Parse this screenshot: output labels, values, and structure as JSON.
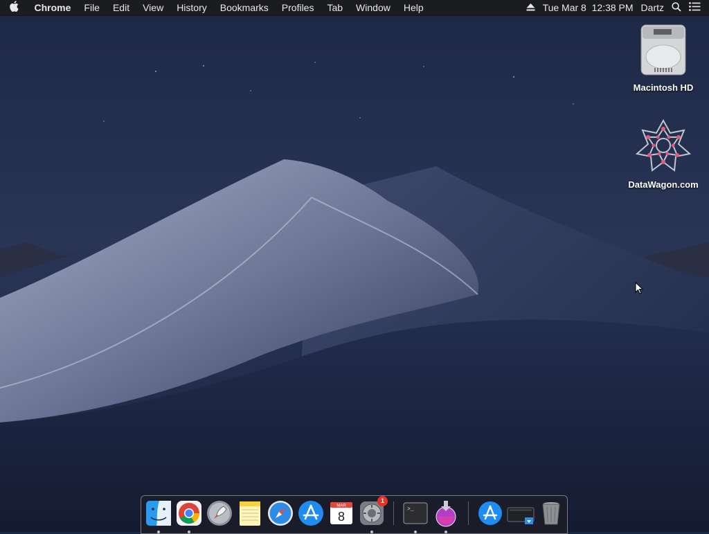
{
  "menubar": {
    "app_name": "Chrome",
    "menus": [
      "File",
      "Edit",
      "View",
      "History",
      "Bookmarks",
      "Profiles",
      "Tab",
      "Window",
      "Help"
    ],
    "datetime": "Tue Mar 8  12:38 PM",
    "user": "Dartz"
  },
  "desktop_icons": [
    {
      "label": "Macintosh HD",
      "icon": "hard-drive-icon"
    },
    {
      "label": "DataWagon.com",
      "icon": "network-volume-icon"
    }
  ],
  "dock": {
    "items": [
      {
        "name": "Finder",
        "icon": "finder-icon",
        "running": true
      },
      {
        "name": "Google Chrome",
        "icon": "chrome-icon",
        "running": true
      },
      {
        "name": "Launchpad",
        "icon": "launchpad-icon",
        "running": false
      },
      {
        "name": "Notes",
        "icon": "notes-icon",
        "running": false
      },
      {
        "name": "Safari",
        "icon": "safari-icon",
        "running": false
      },
      {
        "name": "App Store",
        "icon": "app-store-icon",
        "running": false
      },
      {
        "name": "Calendar",
        "icon": "calendar-icon",
        "running": false,
        "month": "MAR",
        "day": "8"
      },
      {
        "name": "System Preferences",
        "icon": "gear-icon",
        "running": true,
        "badge": "1"
      },
      {
        "name": "Terminal",
        "icon": "terminal-icon",
        "running": true
      },
      {
        "name": "Installer",
        "icon": "installer-icon",
        "running": true
      },
      {
        "name": "Applications",
        "icon": "applications-folder-icon",
        "running": false
      },
      {
        "name": "Downloads",
        "icon": "downloads-stack-icon",
        "running": false
      },
      {
        "name": "Trash",
        "icon": "trash-icon",
        "running": false
      }
    ]
  },
  "colors": {
    "menubar_bg": "#1b1c1f",
    "sky": "#1f2b4c",
    "dune_light": "#9aa3bd",
    "badge": "#e5332a"
  }
}
